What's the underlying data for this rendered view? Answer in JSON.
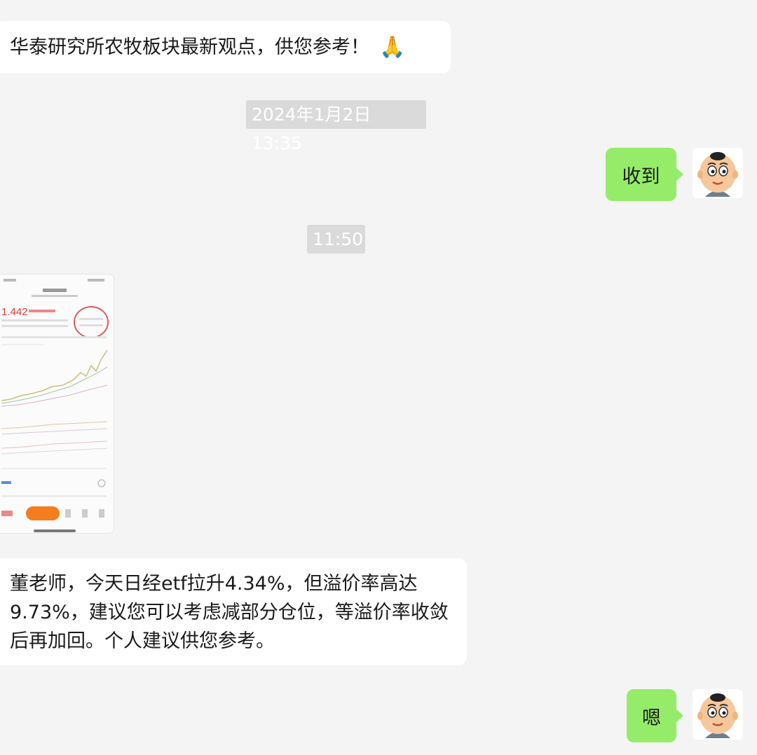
{
  "messages": {
    "msg1_text": "华泰研究所农牧板块最新观点，供您参考！",
    "msg1_emoji": "🙏",
    "time1": "2024年1月2日 13:35",
    "reply1": "收到",
    "time2": "11:50",
    "screenshot": {
      "price": "1.442",
      "description_icon": "stock-chart-screenshot"
    },
    "msg2_text": "董老师，今天日经etf拉升4.34%，但溢价率高达9.73%，建议您可以考虑减部分仓位，等溢价率收敛后再加回。个人建议供您参考。",
    "reply2": "嗯"
  },
  "colors": {
    "background": "#f4f4f4",
    "incoming_bubble": "#ffffff",
    "outgoing_bubble": "#95ec69",
    "time_chip": "#dadada",
    "chart_red": "#e03a3a",
    "orange_button": "#f57c1f"
  }
}
